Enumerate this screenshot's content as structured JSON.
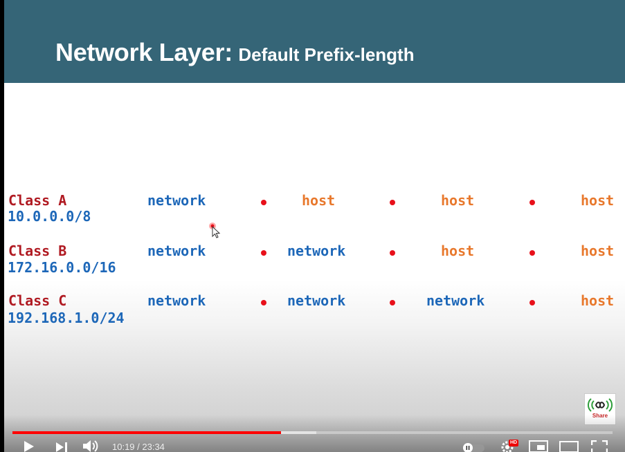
{
  "slide": {
    "title_main": "Network Layer:",
    "title_sub": "Default Prefix-length",
    "rows": [
      {
        "class_label": "Class A",
        "address": "10.0.0.0/8",
        "octets": [
          {
            "text": "network",
            "kind": "network"
          },
          {
            "text": "host",
            "kind": "host"
          },
          {
            "text": "host",
            "kind": "host"
          },
          {
            "text": "host",
            "kind": "host"
          }
        ]
      },
      {
        "class_label": "Class B",
        "address": "172.16.0.0/16",
        "octets": [
          {
            "text": "network",
            "kind": "network"
          },
          {
            "text": "network",
            "kind": "network"
          },
          {
            "text": "host",
            "kind": "host"
          },
          {
            "text": "host",
            "kind": "host"
          }
        ]
      },
      {
        "class_label": "Class C",
        "address": "192.168.1.0/24",
        "octets": [
          {
            "text": "network",
            "kind": "network"
          },
          {
            "text": "network",
            "kind": "network"
          },
          {
            "text": "network",
            "kind": "network"
          },
          {
            "text": "host",
            "kind": "host"
          }
        ]
      }
    ],
    "logo_text": "Share",
    "colors": {
      "title_bar": "#356577",
      "class_label": "#b01a22",
      "network": "#1d67b8",
      "host": "#e8782c",
      "dot": "#e8101a"
    }
  },
  "player": {
    "time_display": "10:19 / 23:34",
    "played_fraction": 0.4476,
    "buffered_fraction": 0.506,
    "hd_badge": "HD",
    "icons": [
      "play-icon",
      "next-icon",
      "volume-icon",
      "autoplay-toggle-icon",
      "settings-icon",
      "miniplayer-icon",
      "theater-mode-icon",
      "fullscreen-icon"
    ]
  }
}
